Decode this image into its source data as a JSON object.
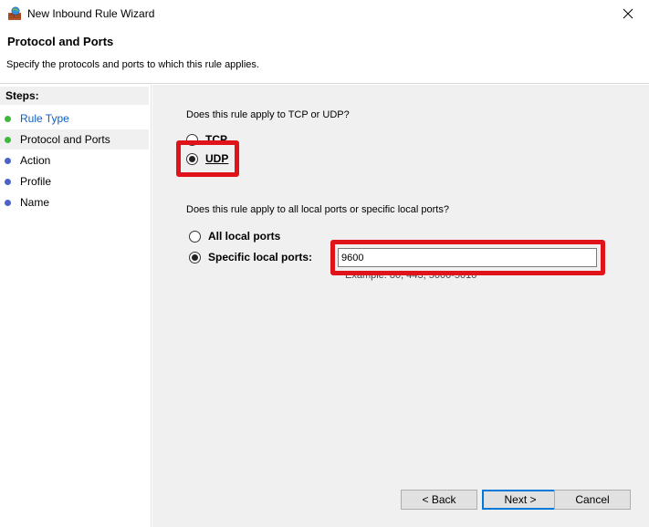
{
  "window": {
    "title": "New Inbound Rule Wizard"
  },
  "header": {
    "title": "Protocol and Ports",
    "subtitle": "Specify the protocols and ports to which this rule applies."
  },
  "steps": {
    "heading": "Steps:",
    "items": [
      {
        "label": "Rule Type",
        "color": "#3cb93c"
      },
      {
        "label": "Protocol and Ports",
        "color": "#3cb93c"
      },
      {
        "label": "Action",
        "color": "#4a63c9"
      },
      {
        "label": "Profile",
        "color": "#4a63c9"
      },
      {
        "label": "Name",
        "color": "#4a63c9"
      }
    ]
  },
  "protocol": {
    "question": "Does this rule apply to TCP or UDP?",
    "tcp_label": "TCP",
    "udp_label": "UDP",
    "selected": "UDP"
  },
  "ports": {
    "question": "Does this rule apply to all local ports or specific local ports?",
    "all_label": "All local ports",
    "specific_label": "Specific local ports:",
    "selected": "Specific local ports",
    "value": "9600",
    "example": "Example: 80, 443, 5000-5010"
  },
  "buttons": {
    "back": "< Back",
    "next": "Next >",
    "cancel": "Cancel"
  },
  "colors": {
    "highlight": "#e0121a",
    "link": "#0b60c8"
  }
}
